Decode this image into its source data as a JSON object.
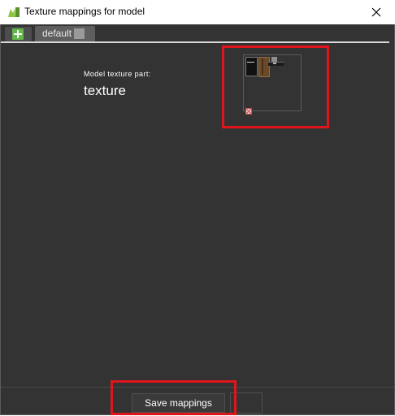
{
  "window": {
    "title": "Texture mappings for model",
    "app_icon": "mcreator-icon",
    "close_icon": "close-icon"
  },
  "tabs": {
    "add_icon": "plus-icon",
    "items": [
      {
        "label": "default",
        "close_icon": "tab-close-icon"
      }
    ]
  },
  "mapping": {
    "caption": "Model texture part:",
    "part_name": "texture",
    "texture_preview_icon": "texture-thumbnail"
  },
  "footer": {
    "save_label": "Save mappings",
    "blank_label": ""
  },
  "colors": {
    "background": "#333333",
    "highlight": "#e0151c",
    "add_green": "#62b84a"
  }
}
